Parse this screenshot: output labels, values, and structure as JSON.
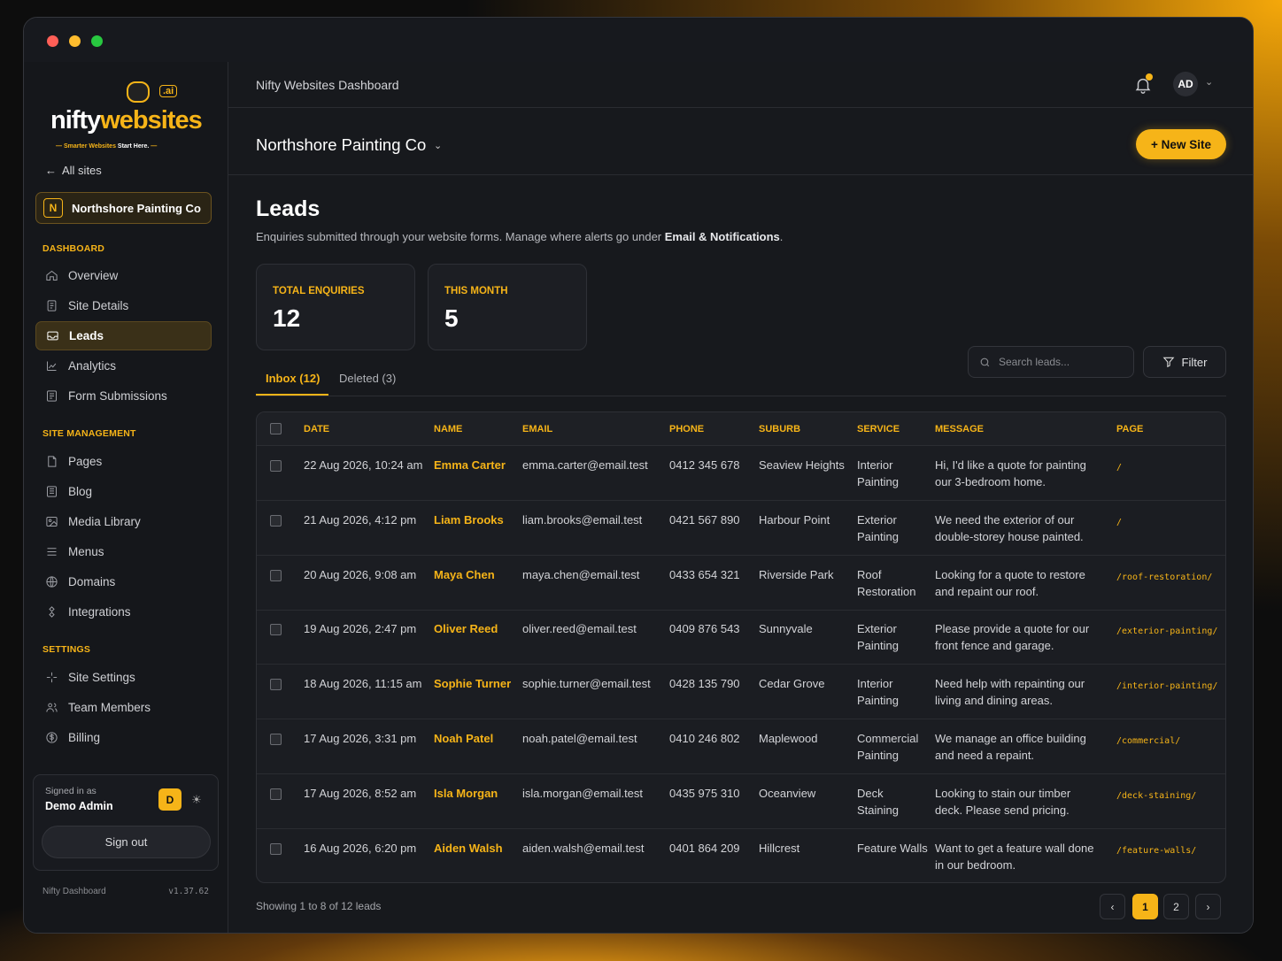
{
  "window": {
    "controls": [
      "close",
      "minimize",
      "zoom"
    ]
  },
  "brand": {
    "logo_main": "nifty",
    "logo_accent": "websites",
    "logo_ai": ".ai",
    "tagline_accent": "Smarter Websites",
    "tagline_rest": " Start Here.",
    "accent_color": "#f6b418"
  },
  "sidebar": {
    "back_label": "All sites",
    "current_site_initial": "N",
    "current_site_name": "Northshore Painting Co",
    "sections": [
      {
        "title": "DASHBOARD",
        "items": [
          {
            "label": "Overview",
            "icon": "home-icon"
          },
          {
            "label": "Site Details",
            "icon": "document-icon"
          },
          {
            "label": "Leads",
            "icon": "inbox-icon",
            "active": true
          },
          {
            "label": "Analytics",
            "icon": "chart-icon"
          },
          {
            "label": "Form Submissions",
            "icon": "form-icon"
          }
        ]
      },
      {
        "title": "SITE MANAGEMENT",
        "items": [
          {
            "label": "Pages",
            "icon": "page-icon"
          },
          {
            "label": "Blog",
            "icon": "blog-icon"
          },
          {
            "label": "Media Library",
            "icon": "image-icon"
          },
          {
            "label": "Menus",
            "icon": "menu-icon"
          },
          {
            "label": "Domains",
            "icon": "globe-icon"
          },
          {
            "label": "Integrations",
            "icon": "plug-icon"
          }
        ]
      },
      {
        "title": "SETTINGS",
        "items": [
          {
            "label": "Site Settings",
            "icon": "sparkle-icon"
          },
          {
            "label": "Team Members",
            "icon": "users-icon"
          },
          {
            "label": "Billing",
            "icon": "dollar-icon"
          }
        ]
      }
    ],
    "user": {
      "signed_label": "Signed in as",
      "name": "Demo Admin",
      "initial": "D",
      "signout_label": "Sign out"
    },
    "footer": {
      "app": "Nifty Dashboard",
      "version": "v1.37.62"
    }
  },
  "topbar": {
    "title": "Nifty Websites Dashboard",
    "avatar": "AD"
  },
  "sitebar": {
    "site_name": "Northshore Painting Co",
    "new_site_label": "+ New Site"
  },
  "page": {
    "title": "Leads",
    "subtitle_pre": "Enquiries submitted through your website forms. Manage where alerts go under ",
    "subtitle_link": "Email & Notifications",
    "subtitle_post": "."
  },
  "stats": [
    {
      "label": "TOTAL ENQUIRIES",
      "value": "12"
    },
    {
      "label": "THIS MONTH",
      "value": "5"
    }
  ],
  "tabs": [
    {
      "label": "Inbox (12)",
      "active": true
    },
    {
      "label": "Deleted (3)",
      "active": false
    }
  ],
  "search": {
    "placeholder": "Search leads..."
  },
  "filter_label": "Filter",
  "table": {
    "columns": [
      "DATE",
      "NAME",
      "EMAIL",
      "PHONE",
      "SUBURB",
      "SERVICE",
      "MESSAGE",
      "PAGE"
    ],
    "rows": [
      {
        "date": "22 Aug 2026, 10:24 am",
        "name": "Emma Carter",
        "email": "emma.carter@email.test",
        "phone": "0412 345 678",
        "suburb": "Seaview Heights",
        "service": [
          "Interior",
          "Painting"
        ],
        "message": [
          "Hi, I'd like a quote for painting",
          "our 3-bedroom home."
        ],
        "page": "/"
      },
      {
        "date": "21 Aug 2026, 4:12 pm",
        "name": "Liam Brooks",
        "email": "liam.brooks@email.test",
        "phone": "0421 567 890",
        "suburb": "Harbour Point",
        "service": [
          "Exterior",
          "Painting"
        ],
        "message": [
          "We need the exterior of our",
          "double-storey house painted."
        ],
        "page": "/"
      },
      {
        "date": "20 Aug 2026, 9:08 am",
        "name": "Maya Chen",
        "email": "maya.chen@email.test",
        "phone": "0433 654 321",
        "suburb": "Riverside Park",
        "service": [
          "Roof",
          "Restoration"
        ],
        "message": [
          "Looking for a quote to restore",
          "and repaint our roof."
        ],
        "page": "/roof-restoration/"
      },
      {
        "date": "19 Aug 2026, 2:47 pm",
        "name": "Oliver Reed",
        "email": "oliver.reed@email.test",
        "phone": "0409 876 543",
        "suburb": "Sunnyvale",
        "service": [
          "Exterior",
          "Painting"
        ],
        "message": [
          "Please provide a quote for our",
          "front fence and garage."
        ],
        "page": "/exterior-painting/"
      },
      {
        "date": "18 Aug 2026, 11:15 am",
        "name": "Sophie Turner",
        "email": "sophie.turner@email.test",
        "phone": "0428 135 790",
        "suburb": "Cedar Grove",
        "service": [
          "Interior",
          "Painting"
        ],
        "message": [
          "Need help with repainting our",
          "living and dining areas."
        ],
        "page": "/interior-painting/"
      },
      {
        "date": "17 Aug 2026, 3:31 pm",
        "name": "Noah Patel",
        "email": "noah.patel@email.test",
        "phone": "0410 246 802",
        "suburb": "Maplewood",
        "service": [
          "Commercial",
          "Painting"
        ],
        "message": [
          "We manage an office building",
          "and need a repaint."
        ],
        "page": "/commercial/"
      },
      {
        "date": "17 Aug 2026, 8:52 am",
        "name": "Isla Morgan",
        "email": "isla.morgan@email.test",
        "phone": "0435 975 310",
        "suburb": "Oceanview",
        "service": [
          "Deck",
          "Staining"
        ],
        "message": [
          "Looking to stain our timber",
          "deck. Please send pricing."
        ],
        "page": "/deck-staining/"
      },
      {
        "date": "16 Aug 2026, 6:20 pm",
        "name": "Aiden Walsh",
        "email": "aiden.walsh@email.test",
        "phone": "0401 864 209",
        "suburb": "Hillcrest",
        "service": [
          "Feature Walls",
          ""
        ],
        "message": [
          "Want to get a feature wall done",
          "in our bedroom."
        ],
        "page": "/feature-walls/"
      }
    ]
  },
  "pagination": {
    "summary": "Showing 1 to 8 of 12 leads",
    "pages": [
      "1",
      "2"
    ],
    "current": "1",
    "prev": "‹",
    "next": "›"
  }
}
